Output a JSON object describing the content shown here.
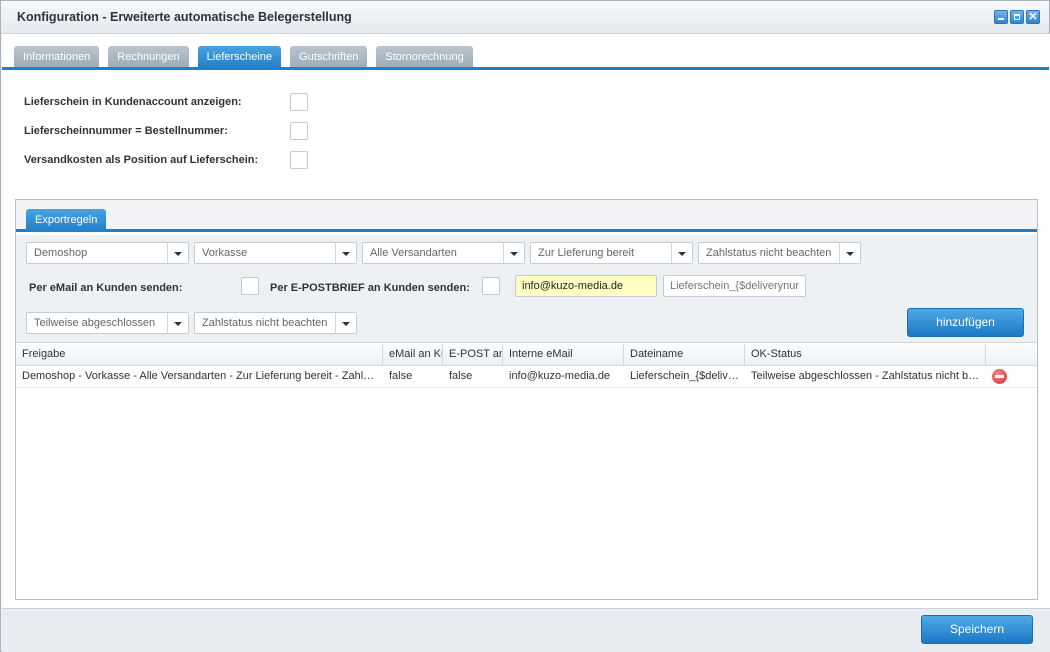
{
  "window": {
    "title": "Konfiguration - Erweiterte automatische Belegerstellung"
  },
  "tabs": [
    {
      "label": "Informationen"
    },
    {
      "label": "Rechnungen"
    },
    {
      "label": "Lieferscheine"
    },
    {
      "label": "Gutschriften"
    },
    {
      "label": "Stornorechnung"
    }
  ],
  "form": {
    "fields": [
      {
        "label": "Lieferschein in Kundenaccount anzeigen:"
      },
      {
        "label": "Lieferscheinnummer = Bestellnummer:"
      },
      {
        "label": "Versandkosten als Position auf Lieferschein:"
      }
    ]
  },
  "panel": {
    "tab_label": "Exportregeln",
    "combos_row1": [
      {
        "value": "Demoshop"
      },
      {
        "value": "Vorkasse"
      },
      {
        "value": "Alle Versandarten"
      },
      {
        "value": "Zur Lieferung bereit"
      },
      {
        "value": "Zahlstatus nicht beachten"
      }
    ],
    "email_label": "Per eMail an Kunden senden:",
    "epost_label": "Per E-POSTBRIEF an Kunden senden:",
    "email_value": "info@kuzo-media.de",
    "filename_placeholder": "Lieferschein_{$deliverynumber}",
    "combos_row3": [
      {
        "value": "Teilweise abgeschlossen"
      },
      {
        "value": "Zahlstatus nicht beachten"
      }
    ],
    "add_button": "hinzufügen"
  },
  "grid": {
    "columns": [
      "Freigabe",
      "eMail an Kunden",
      "E-POST an Kunden",
      "Interne eMail",
      "Dateiname",
      "OK-Status"
    ],
    "rows": [
      {
        "freigabe": "Demoshop - Vorkasse - Alle Versandarten - Zur Lieferung bereit - Zahlstatus nicht beachten",
        "email": "false",
        "epost": "false",
        "intern": "info@kuzo-media.de",
        "datei": "Lieferschein_{$deliverynumber}",
        "status": "Teilweise abgeschlossen - Zahlstatus nicht beachten"
      }
    ]
  },
  "footer": {
    "save_button": "Speichern"
  }
}
